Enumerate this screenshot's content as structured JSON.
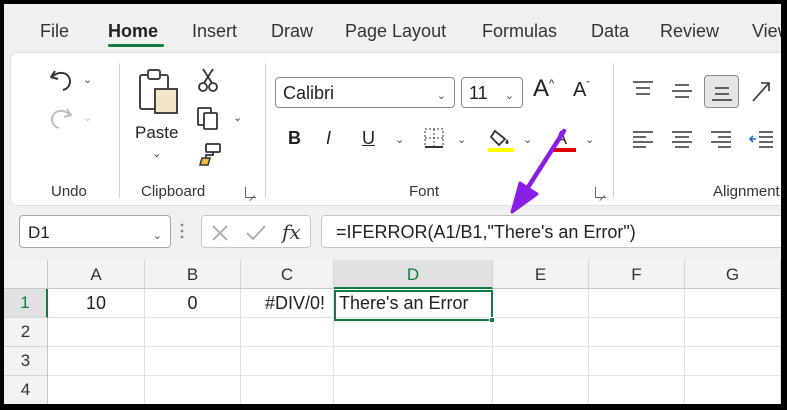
{
  "tabs": [
    "File",
    "Home",
    "Insert",
    "Draw",
    "Page Layout",
    "Formulas",
    "Data",
    "Review",
    "View"
  ],
  "ribbon": {
    "undo_group_label": "Undo",
    "clipboard_group_label": "Clipboard",
    "paste_label": "Paste",
    "font_group_label": "Font",
    "alignment_group_label": "Alignment",
    "font_name": "Calibri",
    "font_size": "11",
    "bold": "B",
    "italic": "I",
    "underline": "U",
    "highlight_color": "#ffff00",
    "font_color": "#e00000"
  },
  "formula_bar": {
    "name_box": "D1",
    "fx": "fx",
    "formula": "=IFERROR(A1/B1,\"There's an Error\")"
  },
  "grid": {
    "columns": [
      "A",
      "B",
      "C",
      "D",
      "E",
      "F",
      "G"
    ],
    "rows": [
      "1",
      "2",
      "3",
      "4"
    ],
    "selected_column": "D",
    "selected_row": "1",
    "cells": {
      "A1": "10",
      "B1": "0",
      "C1": "#DIV/0!",
      "D1": "There's an Error"
    }
  },
  "colors": {
    "accent": "#107c41",
    "annotation_arrow": "#8b1ee6"
  }
}
